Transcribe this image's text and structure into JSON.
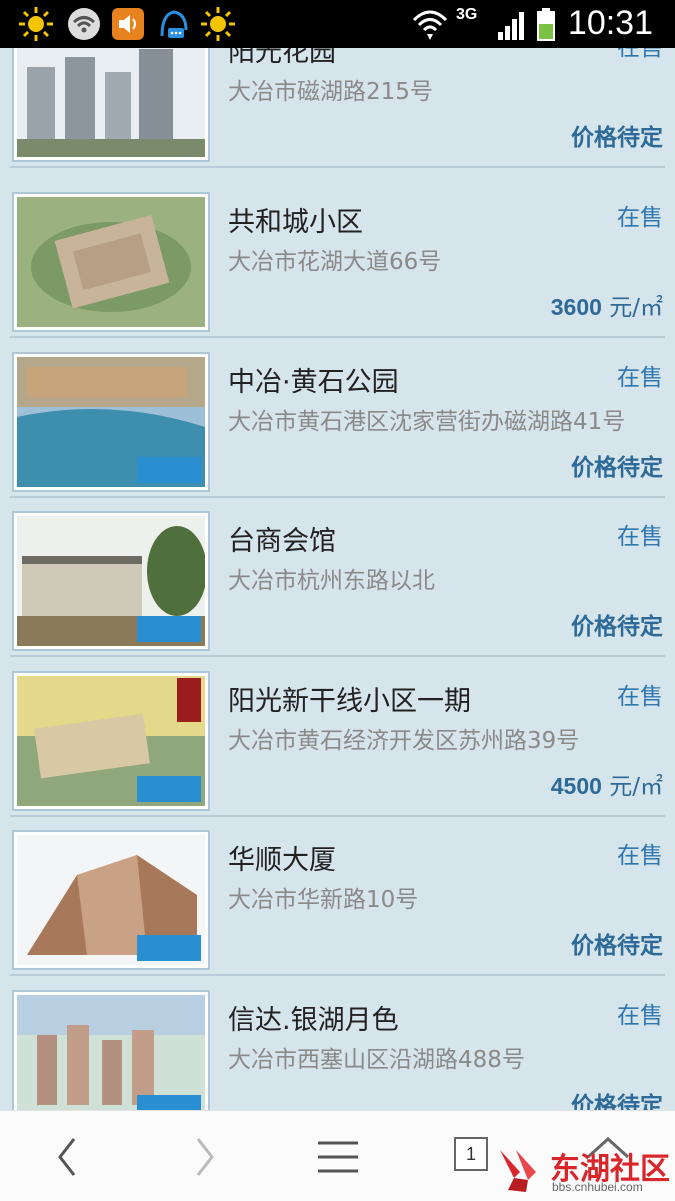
{
  "status_bar": {
    "time": "10:31",
    "network": "3G",
    "icons": [
      "sun-icon",
      "wifi-icon",
      "volume-icon",
      "notification-icon",
      "sun-icon",
      "wifi-signal-icon",
      "cell-signal-icon",
      "battery-icon"
    ]
  },
  "listings": [
    {
      "title": "阳光花园",
      "address": "大冶市磁湖路215号",
      "status": "在售",
      "price": "价格待定",
      "price_num": "",
      "price_unit": ""
    },
    {
      "title": "共和城小区",
      "address": "大冶市花湖大道66号",
      "status": "在售",
      "price": "",
      "price_num": "3600",
      "price_unit": " 元/㎡"
    },
    {
      "title": "中冶·黄石公园",
      "address": "大冶市黄石港区沈家营街办磁湖路41号",
      "status": "在售",
      "price": "价格待定",
      "price_num": "",
      "price_unit": ""
    },
    {
      "title": "台商会馆",
      "address": "大冶市杭州东路以北",
      "status": "在售",
      "price": "价格待定",
      "price_num": "",
      "price_unit": ""
    },
    {
      "title": "阳光新干线小区一期",
      "address": "大冶市黄石经济开发区苏州路39号",
      "status": "在售",
      "price": "",
      "price_num": "4500",
      "price_unit": " 元/㎡"
    },
    {
      "title": "华顺大厦",
      "address": "大冶市华新路10号",
      "status": "在售",
      "price": "价格待定",
      "price_num": "",
      "price_unit": ""
    },
    {
      "title": "信达.银湖月色",
      "address": "大冶市西塞山区沿湖路488号",
      "status": "在售",
      "price": "价格待定",
      "price_num": "",
      "price_unit": ""
    }
  ],
  "bottom_nav": {
    "tab_count": "1",
    "watermark_text": "东湖社区",
    "watermark_url": "bbs.cnhubei.com"
  }
}
